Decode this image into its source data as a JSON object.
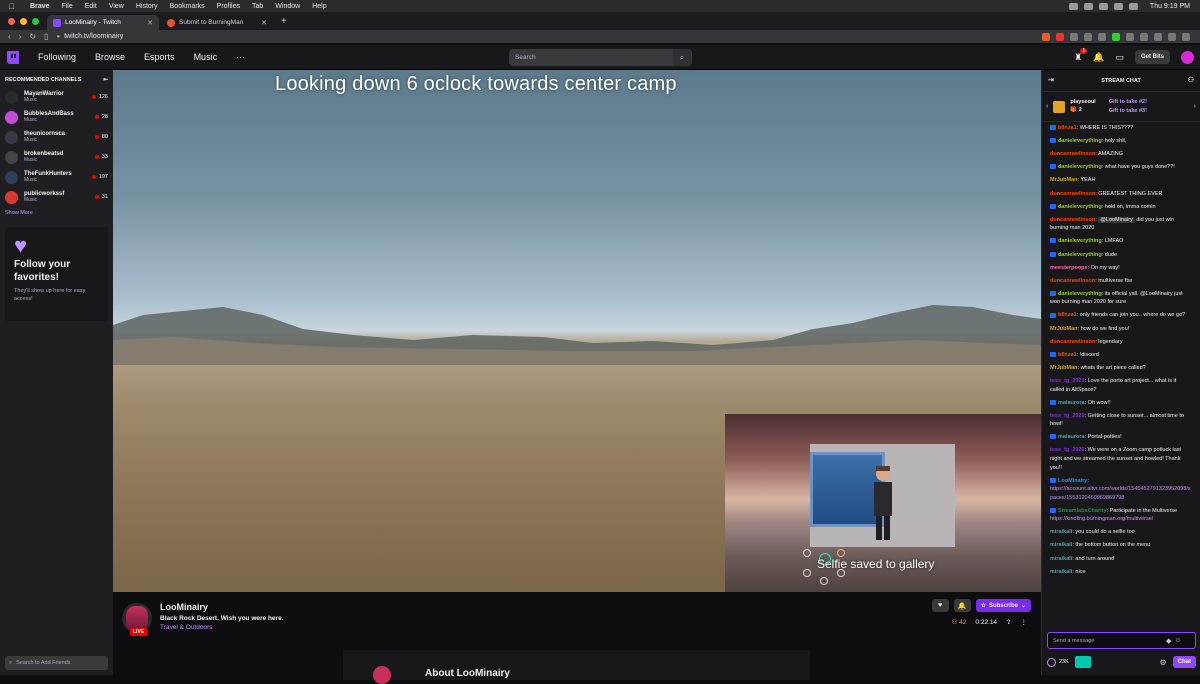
{
  "menubar": {
    "app": "Brave",
    "items": [
      "File",
      "Edit",
      "View",
      "History",
      "Bookmarks",
      "Profiles",
      "Tab",
      "Window",
      "Help"
    ],
    "clock": "Thu 9:19 PM"
  },
  "tabs": [
    {
      "title": "LooMinairy - Twitch",
      "active": true
    },
    {
      "title": "Submit to BurningMan",
      "active": false
    }
  ],
  "address": {
    "url": "twitch.tv/loominairy"
  },
  "twitch_nav": {
    "links": [
      "Following",
      "Browse",
      "Esports",
      "Music"
    ],
    "more": "⋯",
    "search_placeholder": "Search",
    "notif_count": "1",
    "whisper_count": "",
    "get_bits": "Get Bits"
  },
  "sidebar": {
    "header": "RECOMMENDED CHANNELS",
    "channels": [
      {
        "name": "MayanWarrior",
        "category": "Music",
        "viewers": "126",
        "color": "#2b2b2b"
      },
      {
        "name": "BubblesAndBass",
        "category": "Music",
        "viewers": "28",
        "color": "#c14fd6"
      },
      {
        "name": "theunicornsca",
        "category": "Music",
        "viewers": "80",
        "color": "#3a3a46"
      },
      {
        "name": "brokenbeatsd",
        "category": "Music",
        "viewers": "33",
        "color": "#444"
      },
      {
        "name": "TheFunkHunters",
        "category": "Music",
        "viewers": "197",
        "color": "#2f3f5c"
      },
      {
        "name": "publicworkssf",
        "category": "Music",
        "viewers": "31",
        "color": "#d83a2f"
      }
    ],
    "show_more": "Show More",
    "follow_title": "Follow your favorites!",
    "follow_body": "They'll show up here for easy access!",
    "friend_search_placeholder": "Search to Add Friends"
  },
  "video": {
    "overlay_text": "Looking down 6 oclock towards center camp",
    "selfie_toast": "Selfie saved to gallery"
  },
  "channel": {
    "name": "LooMinairy",
    "live": "LIVE",
    "title": "Black Rock Desert. Wish you were here.",
    "category": "Travel & Outdoors",
    "subscribe": "Subscribe",
    "viewers": "42",
    "uptime": "0:22:14",
    "about": "About LooMinairy"
  },
  "chat": {
    "header": "STREAM CHAT",
    "gift_user": "playseoul",
    "gift_count": "2",
    "gift_take_2": "Gift to take #2!",
    "gift_take_3": "Gift to take #3!",
    "messages": [
      {
        "user": "b8nza1",
        "color": "#ff4500",
        "badge": true,
        "text": "WHERE IS THIS????"
      },
      {
        "user": "danieleverything",
        "color": "#9acd32",
        "badge": true,
        "text": "holy shit,"
      },
      {
        "user": "duncanrawlinson",
        "color": "#ff4500",
        "badge": false,
        "text": "AMAZING"
      },
      {
        "user": "danieleverything",
        "color": "#9acd32",
        "badge": true,
        "text": "what have you guys done??!"
      },
      {
        "user": "MrJubMan",
        "color": "#daa520",
        "badge": false,
        "text": "YEAH"
      },
      {
        "user": "duncanrawlinson",
        "color": "#ff4500",
        "badge": false,
        "text": "GREATEST THING EVER"
      },
      {
        "user": "danieleverything",
        "color": "#9acd32",
        "badge": true,
        "text": "hold on, imma comin"
      },
      {
        "user": "duncanrawlinson",
        "color": "#ff4500",
        "badge": false,
        "mention": "@LooMinairy",
        "text": "did you just win burning man 2020"
      },
      {
        "user": "danieleverything",
        "color": "#9acd32",
        "badge": true,
        "text": "LMFAO"
      },
      {
        "user": "danieleverything",
        "color": "#9acd32",
        "badge": true,
        "text": "dude"
      },
      {
        "user": "meesterpoops",
        "color": "#ff69b4",
        "badge": false,
        "text": "On my way!"
      },
      {
        "user": "duncanrawlinson",
        "color": "#ff4500",
        "badge": false,
        "text": "multiverse ftw"
      },
      {
        "user": "danieleverything",
        "color": "#9acd32",
        "badge": true,
        "text": "its official yall. @LooMinairy just won burning man 2020 for sure"
      },
      {
        "user": "b8nza1",
        "color": "#ff4500",
        "badge": true,
        "text": "only friends can join you.. where do we go?"
      },
      {
        "user": "MrJubMan",
        "color": "#daa520",
        "badge": false,
        "text": "how do we find you!"
      },
      {
        "user": "duncanrawlinson",
        "color": "#ff4500",
        "badge": false,
        "text": "legendary"
      },
      {
        "user": "b8nza1",
        "color": "#ff4500",
        "badge": true,
        "text": "!discord"
      },
      {
        "user": "MrJubMan",
        "color": "#daa520",
        "badge": false,
        "text": "whats the art piece called?"
      },
      {
        "user": "tess_tg_2020",
        "color": "#8a2be2",
        "badge": false,
        "text": "Love the porto art project... what is it called in AltSpace?"
      },
      {
        "user": "maiaurora",
        "color": "#5f9ea0",
        "badge": true,
        "text": "Oh wow!!"
      },
      {
        "user": "tess_tg_2020",
        "color": "#8a2be2",
        "badge": false,
        "text": "Getting close to sunset... almost time to howl!"
      },
      {
        "user": "maiaurora",
        "color": "#5f9ea0",
        "badge": true,
        "text": "Portal-potties!"
      },
      {
        "user": "tess_tg_2020",
        "color": "#8a2be2",
        "badge": false,
        "text": "We were on a Zoom camp potluck last night and we streamed the sunset and howled! Thank you!!"
      },
      {
        "user": "LooMinairy",
        "color": "#1e90ff",
        "badge": true,
        "link": "https://account.altvr.com/worlds/1545452791323952098/spaces/1553120460969869798",
        "text": ""
      },
      {
        "user": "StreamlabsCharity",
        "color": "#2e8b57",
        "badge": true,
        "text": "Participate in the Multiverse",
        "link": "https://kindling.burningman.org/multiverse/"
      },
      {
        "user": "miraikali",
        "color": "#5f9ea0",
        "badge": false,
        "text": "you could do a selfie too"
      },
      {
        "user": "miraikali",
        "color": "#5f9ea0",
        "badge": false,
        "text": "the bottom button on the menu"
      },
      {
        "user": "miraikali",
        "color": "#5f9ea0",
        "badge": false,
        "text": "and turn around"
      },
      {
        "user": "miraikali",
        "color": "#5f9ea0",
        "badge": false,
        "text": "nice"
      }
    ],
    "input_placeholder": "Send a message",
    "points": "23K",
    "send_label": "Chat"
  }
}
